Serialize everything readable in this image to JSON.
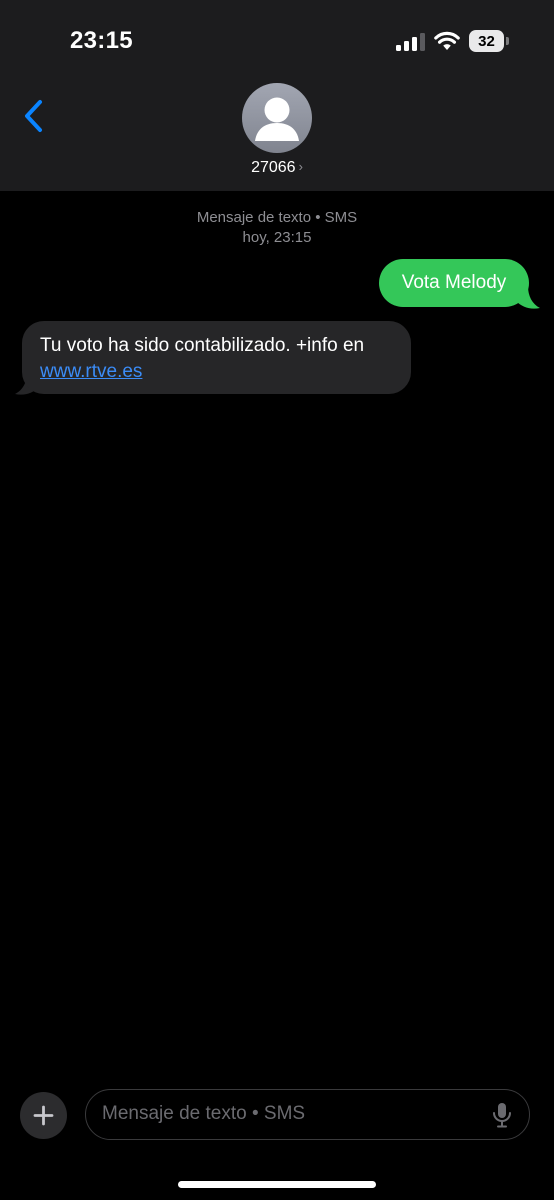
{
  "status_bar": {
    "time": "23:15",
    "battery_level": "32",
    "signal_bars_active": 3,
    "signal_bars_total": 4
  },
  "nav": {
    "back_icon": "chevron-left-icon",
    "contact_name": "27066",
    "contact_chevron": "›",
    "avatar_icon": "person-silhouette-icon"
  },
  "conversation": {
    "service_label": "Mensaje de texto • SMS",
    "timestamp": "hoy, 23:15"
  },
  "messages": [
    {
      "direction": "outgoing",
      "text": "Vota Melody"
    },
    {
      "direction": "incoming",
      "text_before_link": "Tu voto ha sido contabilizado. +info en",
      "link_text": "www.rtve.es"
    }
  ],
  "compose": {
    "placeholder": "Mensaje de texto • SMS",
    "value": "",
    "plus_icon": "plus-icon",
    "mic_icon": "microphone-icon"
  },
  "colors": {
    "accent_blue": "#0a84ff",
    "link_blue": "#3b8cf7",
    "outgoing_bubble": "#34c759",
    "incoming_bubble": "#262628",
    "header_background": "#1c1c1e",
    "background": "#000000",
    "meta_text": "#8e8e93"
  }
}
